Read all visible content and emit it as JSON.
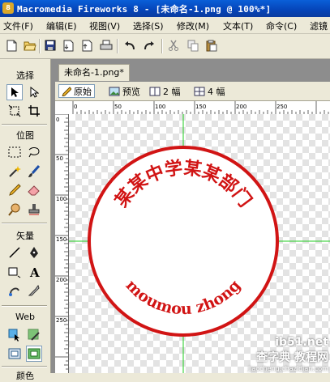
{
  "window": {
    "app_icon_text": "8",
    "title": "Macromedia Fireworks 8 - [未命名-1.png @ 100%*]"
  },
  "menu": [
    "文件(F)",
    "编辑(E)",
    "视图(V)",
    "选择(S)",
    "修改(M)",
    "文本(T)",
    "命令(C)",
    "滤镜"
  ],
  "toolbar_icons": [
    "new-file-icon",
    "open-folder-icon",
    "save-icon",
    "import-icon",
    "export-icon",
    "print-icon",
    "undo-icon",
    "redo-icon",
    "cut-icon",
    "copy-icon",
    "paste-icon"
  ],
  "tools_panel": {
    "select_heading": "选择",
    "bitmap_heading": "位图",
    "vector_heading": "矢量",
    "web_heading": "Web",
    "colors_heading": "颜色"
  },
  "document": {
    "tab_label": "未命名-1.png*",
    "view_tabs": [
      "原始",
      "预览",
      "2 幅",
      "4 幅"
    ],
    "active_view": "原始"
  },
  "rulers": {
    "top_ticks": [
      "0",
      "50",
      "100",
      "150",
      "200",
      "250"
    ],
    "left_ticks": [
      "0",
      "50",
      "100",
      "150",
      "200",
      "250"
    ]
  },
  "stamp": {
    "top_text": "某某中学某某部门",
    "bottom_text": "moumou zhong",
    "color": "#d11414"
  },
  "guide_color": "#22cc22",
  "watermark": {
    "line1": "ib51.net",
    "line2": "查字典 教程网",
    "line3": "jiaocheng.chazidian.com"
  }
}
